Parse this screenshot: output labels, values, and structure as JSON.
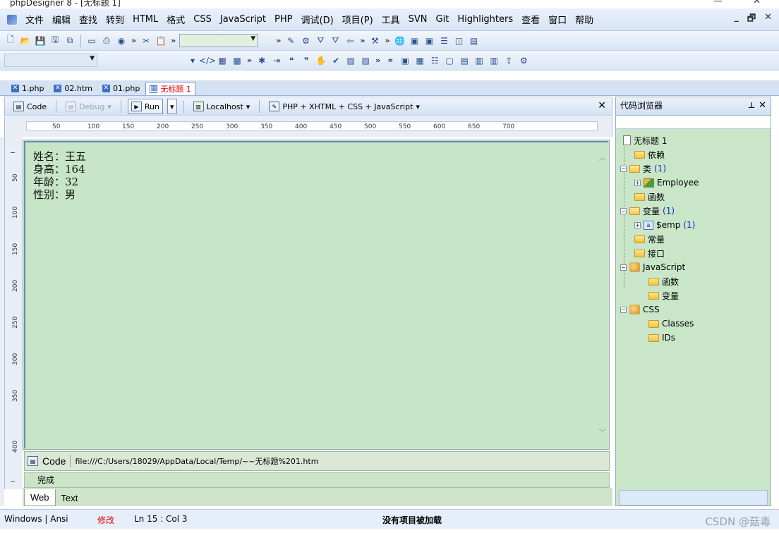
{
  "window": {
    "title": "phpDesigner 8 - [无标题 1]",
    "controls": [
      "—",
      "✕"
    ]
  },
  "menu": {
    "items": [
      "文件",
      "编辑",
      "查找",
      "转到",
      "HTML",
      "格式",
      "CSS",
      "JavaScript",
      "PHP",
      "调试(D)",
      "项目(P)",
      "工具",
      "SVN",
      "Git",
      "Highlighters",
      "查看",
      "窗口",
      "帮助"
    ],
    "window_controls": [
      "_",
      "🗗",
      "✕"
    ]
  },
  "doc_tabs": [
    {
      "label": "1.php",
      "active": false
    },
    {
      "label": "02.htm",
      "active": false
    },
    {
      "label": "01.php",
      "active": false
    },
    {
      "label": "无标题 1",
      "active": true
    }
  ],
  "runbar": {
    "code": "Code",
    "debug": "Debug",
    "run": "Run",
    "server": "Localhost",
    "mode": "PHP + XHTML + CSS + JavaScript"
  },
  "ruler_labels": [
    "50",
    "100",
    "150",
    "200",
    "250",
    "300",
    "350",
    "400",
    "450",
    "500",
    "550",
    "600",
    "650",
    "700"
  ],
  "vruler_labels": [
    "50",
    "100",
    "150",
    "200",
    "250",
    "300",
    "350",
    "400"
  ],
  "preview": {
    "lines": [
      "姓名：王五",
      "身高：164",
      "年龄：32",
      "性别：男"
    ],
    "url_mode": "Code",
    "url": "file:///C:/Users/18029/AppData/Local/Temp/~~无标题%201.htm",
    "status": "完成",
    "tabs": [
      "Web",
      "Text"
    ]
  },
  "code_browser": {
    "title": "代码浏览器",
    "tree": {
      "root": "无标题 1",
      "dependencies": "依赖",
      "classes": "类",
      "classes_count": "(1)",
      "class_employee": "Employee",
      "functions": "函数",
      "variables": "变量",
      "variables_count": "(1)",
      "var_emp": "$emp",
      "var_emp_count": "(1)",
      "constants": "常量",
      "interfaces": "接口",
      "javascript": "JavaScript",
      "js_functions": "函数",
      "js_variables": "变量",
      "css": "CSS",
      "css_classes": "Classes",
      "css_ids": "IDs"
    }
  },
  "statusbar": {
    "encoding": "Windows | Ansi",
    "modified": "修改",
    "position": "Ln   15 : Col  3",
    "project": "没有项目被加载",
    "watermark": "CSDN @菇毒"
  },
  "colors": {
    "preview_bg": "#c7e6c7",
    "modified_text": "#e00000",
    "active_tab_text": "#e00000"
  }
}
